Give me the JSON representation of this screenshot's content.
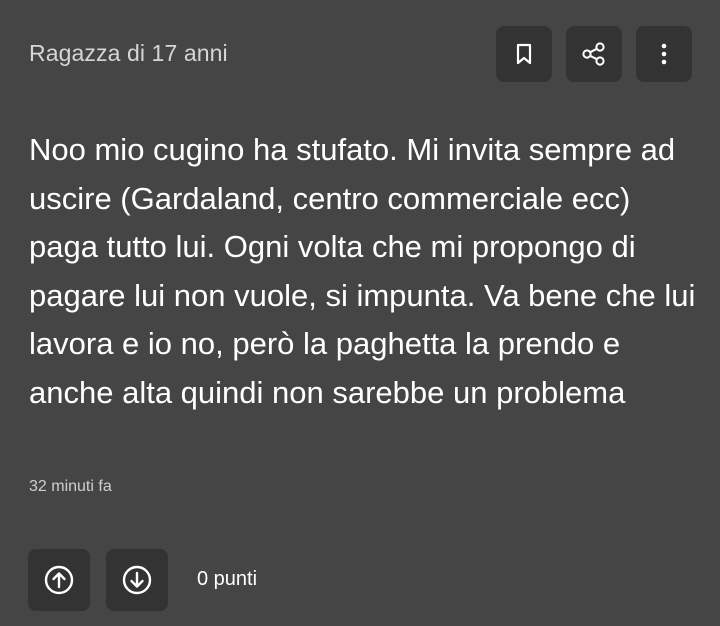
{
  "post": {
    "author": "Ragazza di 17 anni",
    "body": "Noo mio cugino ha stufato. Mi invita sempre ad uscire (Gardaland, centro commerciale ecc) paga tutto lui. Ogni volta che mi propongo di pagare lui non vuole, si impunta. Va bene che lui lavora e io no, però la paghetta la prendo e anche alta quindi non sarebbe un problema",
    "timestamp": "32 minuti fa",
    "points": "0 punti"
  },
  "actions": {
    "bookmark_icon": "bookmark-icon",
    "share_icon": "share-icon",
    "more_icon": "more-vertical-icon",
    "upvote_icon": "arrow-up-circle-icon",
    "downvote_icon": "arrow-down-circle-icon"
  },
  "colors": {
    "background": "#454545",
    "button_bg": "#333333",
    "text": "#ffffff",
    "muted_text": "#d6d6d6"
  }
}
